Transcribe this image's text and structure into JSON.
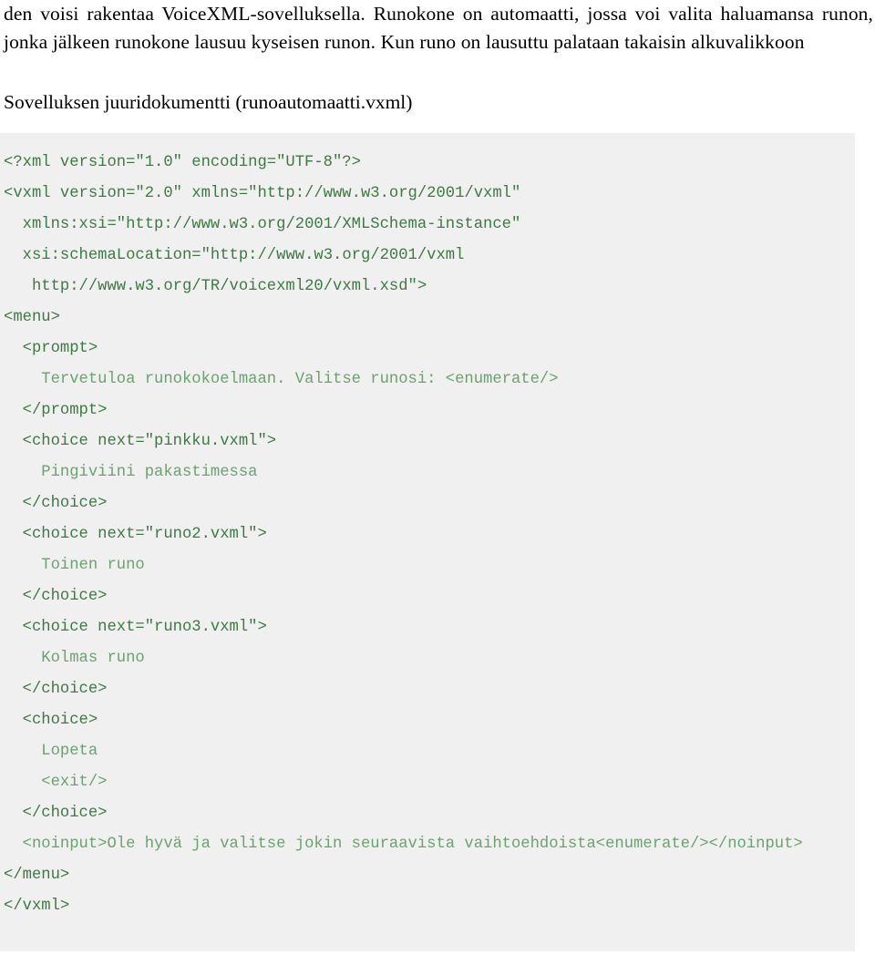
{
  "document": {
    "paragraphs": [
      "den voisi rakentaa VoiceXML-sovelluksella. Runokone on automaatti, jossa voi valita haluamansa runon, jonka jälkeen runokone lausuu kyseisen runon. Kun runo on lausuttu palataan takaisin alkuvalikkoon"
    ],
    "heading": "Sovelluksen juuridokumentti (runoautomaatti.vxml)"
  },
  "code_block": {
    "language": "xml",
    "filename": "runoautomaatti.vxml",
    "colors": {
      "background": "#f0f0f0",
      "tag": "#3d7a42",
      "text_content": "#6aa36f"
    },
    "lines": [
      {
        "kind": "tag",
        "text": "<?xml version=\"1.0\" encoding=\"UTF-8\"?>"
      },
      {
        "kind": "tag",
        "text": "<vxml version=\"2.0\" xmlns=\"http://www.w3.org/2001/vxml\""
      },
      {
        "kind": "tag",
        "text": "  xmlns:xsi=\"http://www.w3.org/2001/XMLSchema-instance\""
      },
      {
        "kind": "tag",
        "text": "  xsi:schemaLocation=\"http://www.w3.org/2001/vxml"
      },
      {
        "kind": "tag",
        "text": "   http://www.w3.org/TR/voicexml20/vxml.xsd\">"
      },
      {
        "kind": "tag",
        "text": "<menu>"
      },
      {
        "kind": "tag",
        "text": "  <prompt>"
      },
      {
        "kind": "text",
        "text": "    Tervetuloa runokokoelmaan. Valitse runosi: <enumerate/>"
      },
      {
        "kind": "tag",
        "text": "  </prompt>"
      },
      {
        "kind": "tag",
        "text": "  <choice next=\"pinkku.vxml\">"
      },
      {
        "kind": "text",
        "text": "    Pingiviini pakastimessa"
      },
      {
        "kind": "tag",
        "text": "  </choice>"
      },
      {
        "kind": "tag",
        "text": "  <choice next=\"runo2.vxml\">"
      },
      {
        "kind": "text",
        "text": "    Toinen runo"
      },
      {
        "kind": "tag",
        "text": "  </choice>"
      },
      {
        "kind": "tag",
        "text": "  <choice next=\"runo3.vxml\">"
      },
      {
        "kind": "text",
        "text": "    Kolmas runo"
      },
      {
        "kind": "tag",
        "text": "  </choice>"
      },
      {
        "kind": "tag",
        "text": "  <choice>"
      },
      {
        "kind": "text",
        "text": "    Lopeta"
      },
      {
        "kind": "text",
        "text": "    <exit/>"
      },
      {
        "kind": "tag",
        "text": "  </choice>"
      },
      {
        "kind": "text",
        "text": "  <noinput>Ole hyvä ja valitse jokin seuraavista vaihtoehdoista<enumerate/></noinput>"
      },
      {
        "kind": "tag",
        "text": "</menu>"
      },
      {
        "kind": "tag",
        "text": "</vxml>"
      }
    ]
  }
}
